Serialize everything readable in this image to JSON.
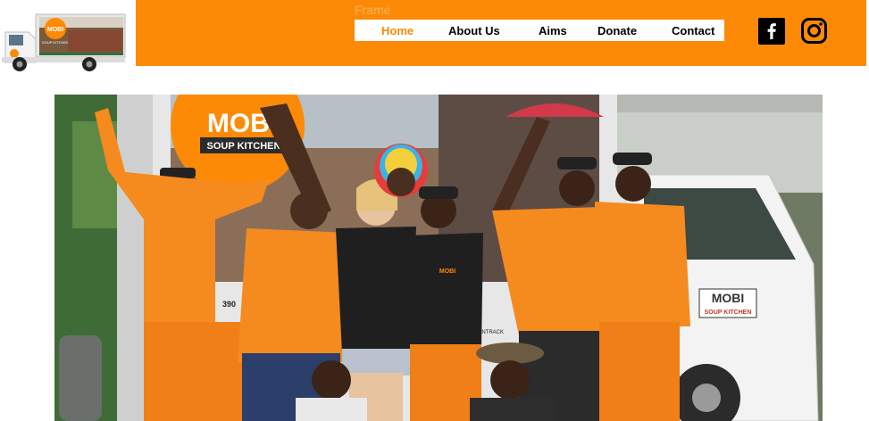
{
  "header": {
    "frame_label": "Frame",
    "nav": [
      {
        "label": "Home",
        "active": true
      },
      {
        "label": "About Us",
        "active": false
      },
      {
        "label": "Aims",
        "active": false
      },
      {
        "label": "Donate",
        "active": false
      },
      {
        "label": "Contact",
        "active": false
      }
    ],
    "social": [
      "facebook-icon",
      "instagram-icon"
    ]
  },
  "logo": {
    "truck_panel_title": "MOBI",
    "truck_panel_sub": "SOUP KITCHEN"
  },
  "hero": {
    "truck_sign_top": "MOBI",
    "truck_sign_bottom": "SOUP KITCHEN",
    "van_sign_top": "MOBI",
    "van_sign_bottom": "SOUP KITCHEN",
    "shirt_logo": "MOBI",
    "plate_digits": "390",
    "plate_text": "CANTRACK"
  },
  "colors": {
    "brand_orange": "#fd8a06",
    "frame_text": "#f7b35c",
    "black": "#000000",
    "white": "#ffffff"
  }
}
